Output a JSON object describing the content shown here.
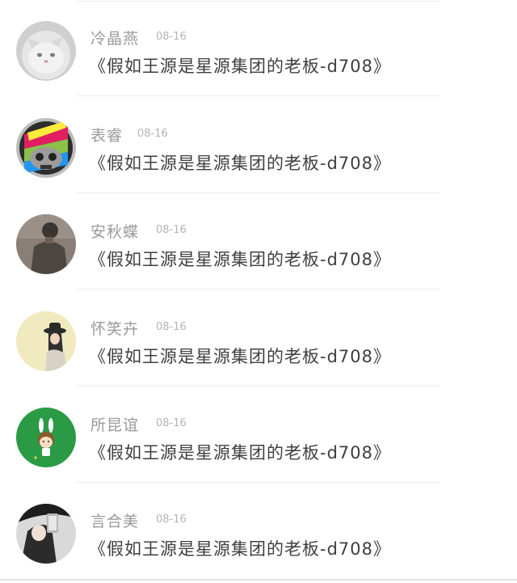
{
  "comments": [
    {
      "name": "冷晶燕",
      "time": "08-16",
      "content": "《假如王源是星源集团的老板-d708》",
      "avatar": "cat-avatar"
    },
    {
      "name": "表睿",
      "time": "08-16",
      "content": "《假如王源是星源集团的老板-d708》",
      "avatar": "skull-avatar"
    },
    {
      "name": "安秋蝶",
      "time": "08-16",
      "content": "《假如王源是星源集团的老板-d708》",
      "avatar": "person-avatar"
    },
    {
      "name": "怀笑卉",
      "time": "08-16",
      "content": "《假如王源是星源集团的老板-d708》",
      "avatar": "girl-hat-avatar"
    },
    {
      "name": "所昆谊",
      "time": "08-16",
      "content": "《假如王源是星源集团的老板-d708》",
      "avatar": "cartoon-bunny-avatar"
    },
    {
      "name": "言合美",
      "time": "08-16",
      "content": "《假如王源是星源集团的老板-d708》",
      "avatar": "phone-selfie-avatar"
    }
  ]
}
